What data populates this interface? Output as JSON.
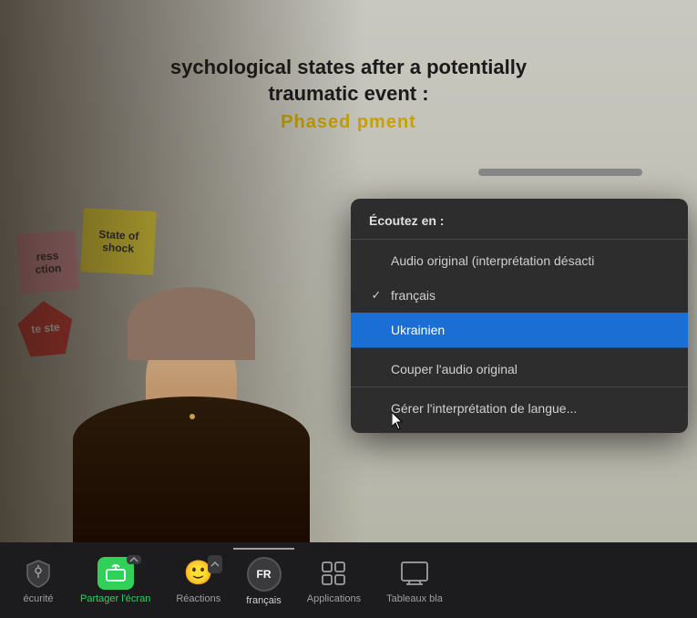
{
  "video": {
    "slide": {
      "title_line1": "sychological states after a potentially",
      "title_line2": "traumatic event :",
      "subtitle": "Phased         pment",
      "sticky1": "ress\nction",
      "sticky2": "State of\nshock",
      "sticky3": "te ste"
    }
  },
  "dropdown": {
    "header": "Écoutez en :",
    "items": [
      {
        "id": "original",
        "label": "Audio original (interprétation désacti",
        "checked": false,
        "selected": false
      },
      {
        "id": "francais",
        "label": "français",
        "checked": true,
        "selected": false
      },
      {
        "id": "ukrainien",
        "label": "Ukrainien",
        "checked": false,
        "selected": true
      },
      {
        "id": "couper",
        "label": "Couper l'audio original",
        "checked": false,
        "selected": false
      },
      {
        "id": "gerer",
        "label": "Gérer l'interprétation de langue...",
        "checked": false,
        "selected": false
      }
    ]
  },
  "toolbar": {
    "items": [
      {
        "id": "securite",
        "label": "écurité",
        "icon": "shield"
      },
      {
        "id": "partager",
        "label": "Partager l'écran",
        "icon": "share",
        "green": true,
        "has_chevron": true
      },
      {
        "id": "reactions",
        "label": "Réactions",
        "icon": "emoji",
        "has_chevron": true
      },
      {
        "id": "francais",
        "label": "français",
        "icon": "fr-circle",
        "active": true
      },
      {
        "id": "applications",
        "label": "Applications",
        "icon": "apps"
      },
      {
        "id": "tableaux",
        "label": "Tableaux bla",
        "icon": "tableaux"
      }
    ]
  }
}
